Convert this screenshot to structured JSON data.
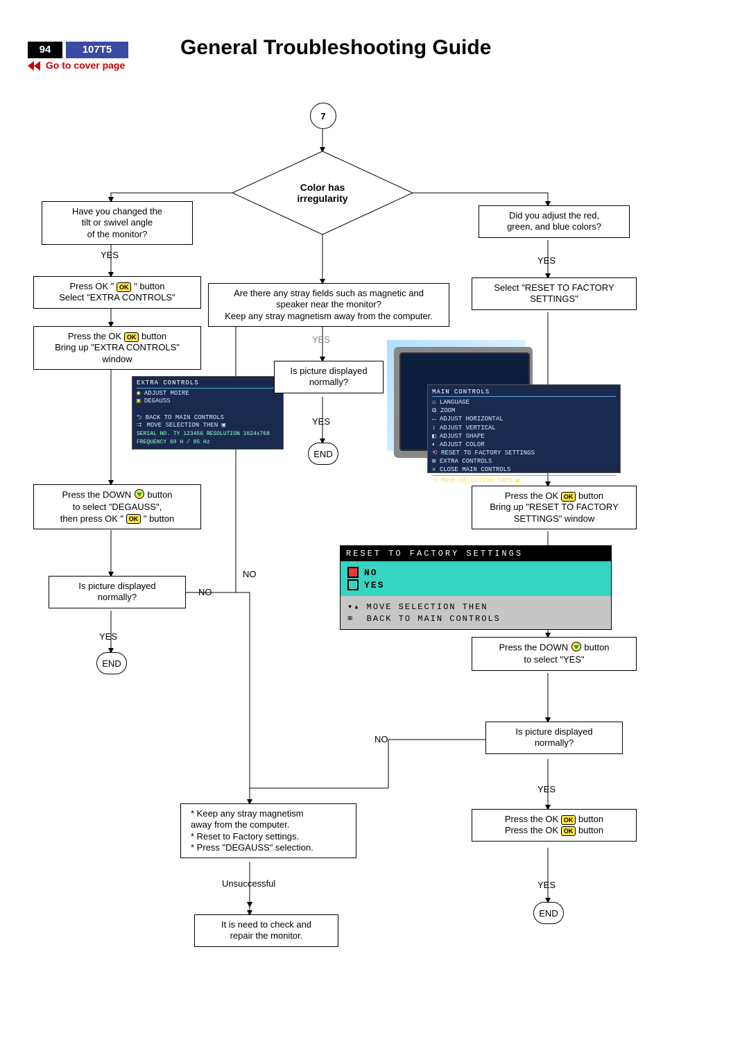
{
  "header": {
    "page_num": "94",
    "model": "107T5",
    "title": "General Troubleshooting Guide",
    "cover_link": "Go to cover page"
  },
  "icons": {
    "ok": "OK"
  },
  "labels": {
    "yes": "YES",
    "no": "NO",
    "end": "END",
    "unsuccessful": "Unsuccessful"
  },
  "flow": {
    "start": "7",
    "diamond": "Color has\nirregularity",
    "left": {
      "b1": "Have you changed the\ntilt or swivel angle\nof the monitor?",
      "b2a": "Press OK \"",
      "b2b": "\" button",
      "b2c": "Select \"EXTRA CONTROLS\"",
      "b3a": "Press the OK",
      "b3b": "button",
      "b3c": "Bring up \"EXTRA CONTROLS\"",
      "b3d": "window",
      "b4a": "Press the DOWN",
      "b4b": "button",
      "b4c": "to select \"DEGAUSS\",",
      "b4d": "then press OK \"",
      "b4e": "\" button",
      "b5": "Is picture displayed\nnormally?"
    },
    "center": {
      "c1": "Are there any stray fields such as magnetic and\nspeaker near the monitor?\nKeep any stray magnetism away from the computer.",
      "c2": "Is picture displayed\nnormally?"
    },
    "right": {
      "r1": "Did you adjust the red,\ngreen, and blue colors?",
      "r2": "Select \"RESET TO FACTORY\nSETTINGS\"",
      "r3a": "Press the OK",
      "r3b": "button",
      "r3c": "Bring up \"RESET TO FACTORY",
      "r3d": "SETTINGS\" window",
      "r4a": "Press the DOWN",
      "r4b": "button",
      "r4c": "to select \"YES\"",
      "r5": "Is picture displayed\nnormally?",
      "r6a": "Press the OK",
      "r6b": "button"
    },
    "merge": {
      "m1": "* Keep any stray magnetism",
      "m2": "  away from the computer.",
      "m3": "* Reset to Factory settings.",
      "m4": "* Press \"DEGAUSS\" selection.",
      "m5": "It is need to check and\nrepair the monitor."
    }
  },
  "osd": {
    "extra": {
      "title": "EXTRA CONTROLS",
      "l1": "ADJUST MOIRE",
      "l2": "DEGAUSS",
      "l3": "BACK TO MAIN CONTROLS",
      "l4": "MOVE SELECTION THEN ▣",
      "l5": "SERIAL NO.  TY 123456   RESOLUTION 1024x768   FREQUENCY 60 H / 85 Hz"
    },
    "main": {
      "title": "MAIN CONTROLS",
      "l1": "LANGUAGE",
      "l2": "ZOOM",
      "l3": "ADJUST HORIZONTAL",
      "l4": "ADJUST VERTICAL",
      "l5": "ADJUST SHAPE",
      "l6": "ADJUST COLOR",
      "l7": "RESET TO FACTORY SETTINGS",
      "l8": "EXTRA CONTROLS",
      "l9": "CLOSE MAIN CONTROLS",
      "l10": "MOVE SELECTION THEN ▣"
    },
    "reset": {
      "title": "RESET TO FACTORY SETTINGS",
      "no": "NO",
      "yes": "YES",
      "f1": "MOVE SELECTION THEN",
      "f2": "BACK TO MAIN CONTROLS"
    }
  }
}
